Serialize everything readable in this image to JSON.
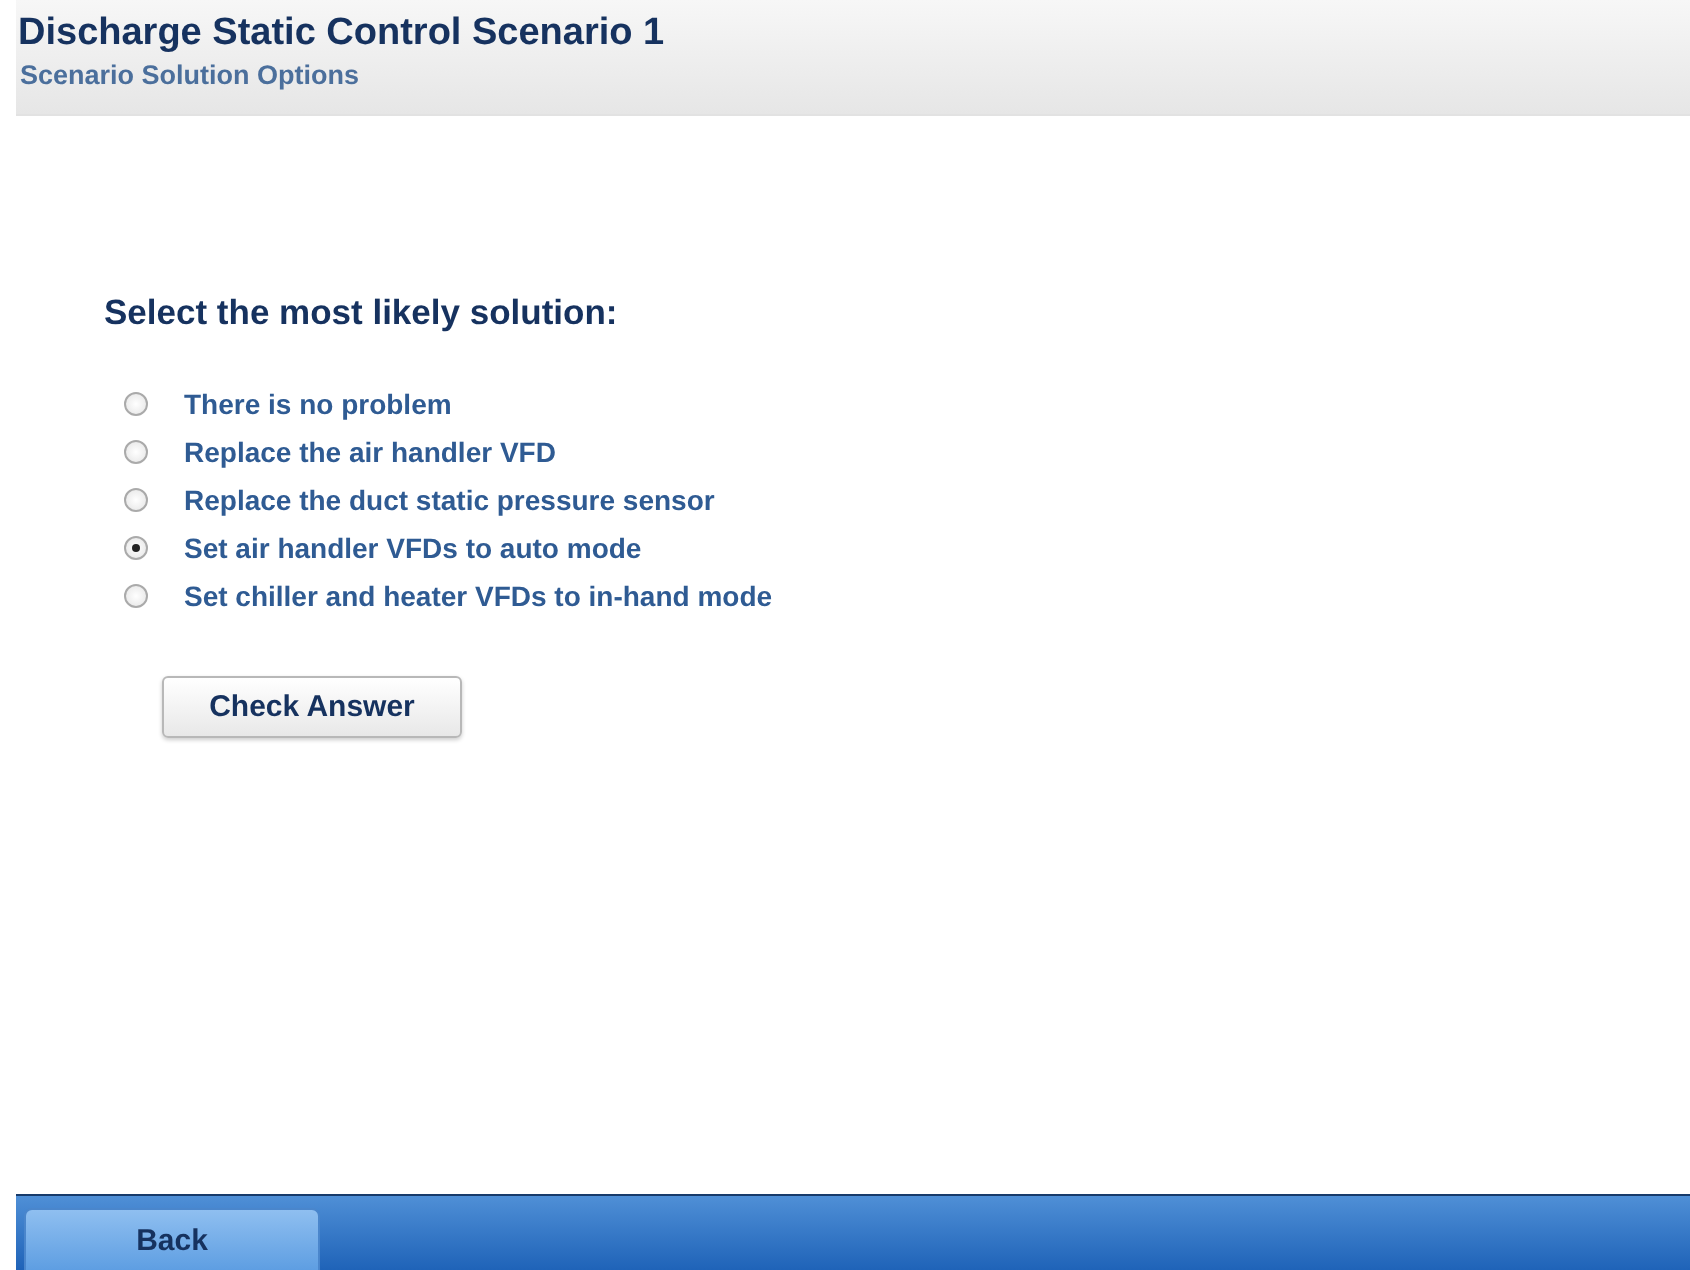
{
  "header": {
    "title": "Discharge Static Control Scenario 1",
    "subtitle": "Scenario Solution Options"
  },
  "question": "Select the most likely solution:",
  "options": [
    {
      "label": "There is no problem",
      "selected": false
    },
    {
      "label": "Replace the air handler VFD",
      "selected": false
    },
    {
      "label": "Replace the duct static pressure sensor",
      "selected": false
    },
    {
      "label": "Set air handler VFDs to auto mode",
      "selected": true
    },
    {
      "label": "Set chiller and heater VFDs to in-hand mode",
      "selected": false
    }
  ],
  "check_button": "Check Answer",
  "footer": {
    "back_button": "Back"
  }
}
